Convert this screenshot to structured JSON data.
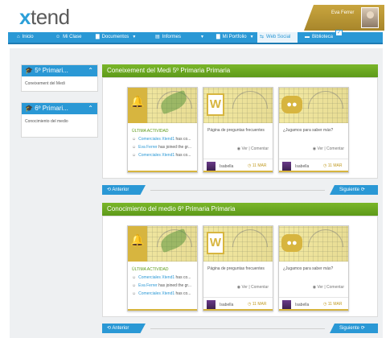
{
  "brand": {
    "logo_x": "x",
    "logo_rest": "tend"
  },
  "user": {
    "name": "Eva Ferrer"
  },
  "nav": {
    "items": [
      {
        "label": "Inicio",
        "icon": "home-icon"
      },
      {
        "label": "Mi Clase",
        "icon": "users-icon"
      },
      {
        "label": "Documentos",
        "icon": "book-icon"
      },
      {
        "label": "Informes",
        "icon": "chart-icon"
      },
      {
        "label": "Mi Portfolio",
        "icon": "book-icon"
      },
      {
        "label": "Web Social",
        "icon": "share-icon"
      },
      {
        "label": "Biblioteca",
        "icon": "library-icon"
      }
    ]
  },
  "sidebar": [
    {
      "title": "5º Primari...",
      "subject": "Coneixement del Medi"
    },
    {
      "title": "6º Primari...",
      "subject": "Conocimiento del medio"
    }
  ],
  "panels": [
    {
      "title": "Coneixement del Medi 5º Primaria Primaria",
      "activity": {
        "title": "ÚLTIMA ACTIVIDAD",
        "rows": [
          {
            "user": "Comerciales Xtend1",
            "text": " has co..."
          },
          {
            "user": "Eva Ferrer",
            "text": " has joined the gr..."
          },
          {
            "user": "Comerciales Xtend1",
            "text": " has co..."
          }
        ]
      },
      "docs": [
        {
          "title": "Página de preguntas frecuentes",
          "actions": "Ver | Comentar",
          "author": "Isabella",
          "badge": "11 MAR"
        },
        {
          "title": "¿Jugamos para saber más?",
          "actions": "Ver | Comentar",
          "author": "Isabella",
          "badge": "11 MAR"
        }
      ],
      "prev": "Anterior",
      "next": "Siguiente"
    },
    {
      "title": "Conocimiento del medio 6º Primaria Primaria",
      "activity": {
        "title": "ÚLTIMA ACTIVIDAD",
        "rows": [
          {
            "user": "Comerciales Xtend1",
            "text": " has co..."
          },
          {
            "user": "Eva Ferrer",
            "text": " has joined the gr..."
          },
          {
            "user": "Comerciales Xtend1",
            "text": " has co..."
          }
        ]
      },
      "docs": [
        {
          "title": "Página de preguntas frecuentes",
          "actions": "Ver | Comentar",
          "author": "Isabella",
          "badge": "11 MAR"
        },
        {
          "title": "¿Jugamos para saber más?",
          "actions": "Ver | Comentar",
          "author": "Isabella",
          "badge": "11 MAR"
        }
      ],
      "prev": "Anterior",
      "next": "Siguiente"
    }
  ]
}
